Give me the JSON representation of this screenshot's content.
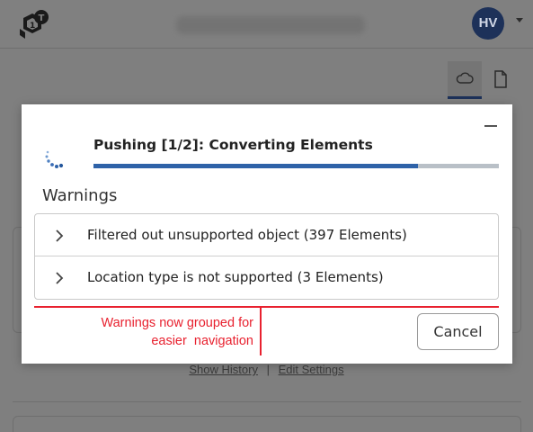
{
  "header": {
    "logo_icon": "logo-icon",
    "avatar_initials": "HV",
    "avatar_color": "#1d3159",
    "menu_icon": "chevron-down-icon"
  },
  "toolbar": {
    "items": [
      {
        "icon": "cloud-icon",
        "active": true
      },
      {
        "icon": "document-icon",
        "active": false
      }
    ]
  },
  "background": {
    "show_history": "Show History",
    "separator": "|",
    "edit_settings": "Edit Settings"
  },
  "dialog": {
    "title": "Pushing [1/2]: Converting Elements",
    "progress": 0.8,
    "progress_color": "#2e62a8",
    "warnings_heading": "Warnings",
    "warnings": [
      {
        "label": "Filtered out unsupported object (397 Elements)"
      },
      {
        "label": "Location type is not supported (3 Elements)"
      }
    ],
    "cancel_label": "Cancel",
    "minimize_icon": "minimize-icon",
    "spinner_icon": "spinner-icon"
  },
  "annotation": {
    "line1": "Warnings now grouped for",
    "line2": "easier  navigation",
    "color": "#e8212f"
  }
}
